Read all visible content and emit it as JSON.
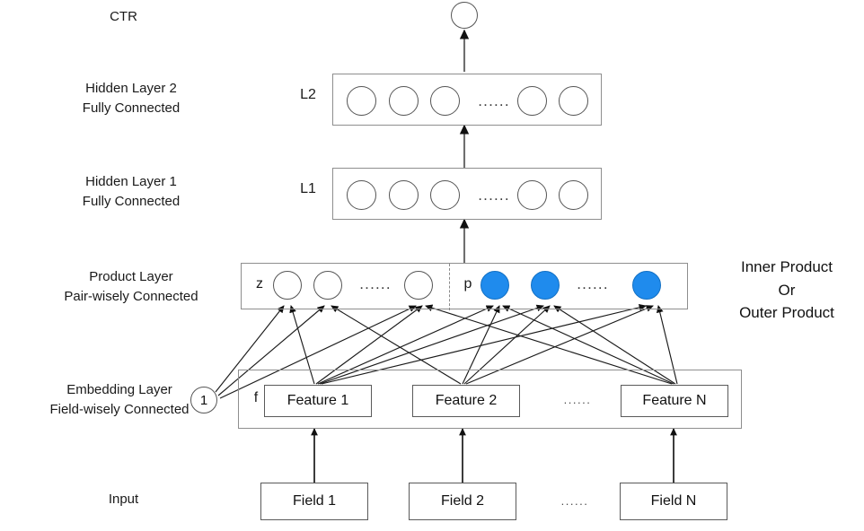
{
  "diagram": {
    "title_labels": {
      "ctr": "CTR",
      "hidden2": "Hidden Layer 2\nFully Connected",
      "hidden1": "Hidden Layer 1\nFully Connected",
      "product": "Product Layer\nPair-wisely Connected",
      "embedding": "Embedding Layer\nField-wisely Connected",
      "input": "Input"
    },
    "side_note": "Inner Product\nOr\nOuter Product",
    "band_tags": {
      "l2": "L2",
      "l1": "L1",
      "z": "z",
      "p": "p",
      "f": "f"
    },
    "bias_node": "1",
    "ellipsis": "......",
    "ellipsis_small": "......",
    "features": [
      "Feature 1",
      "Feature 2",
      "Feature N"
    ],
    "fields": [
      "Field 1",
      "Field 2",
      "Field N"
    ],
    "colors": {
      "node_fill_blue": "#1f8bed",
      "node_stroke": "#555555",
      "band_stroke": "#8e8e8e",
      "box_stroke": "#5a5a5a",
      "text": "#1a1a1a",
      "background": "#ffffff"
    },
    "counts": {
      "l2_nodes": 5,
      "l1_nodes": 5,
      "z_nodes": 3,
      "p_nodes": 3
    }
  }
}
